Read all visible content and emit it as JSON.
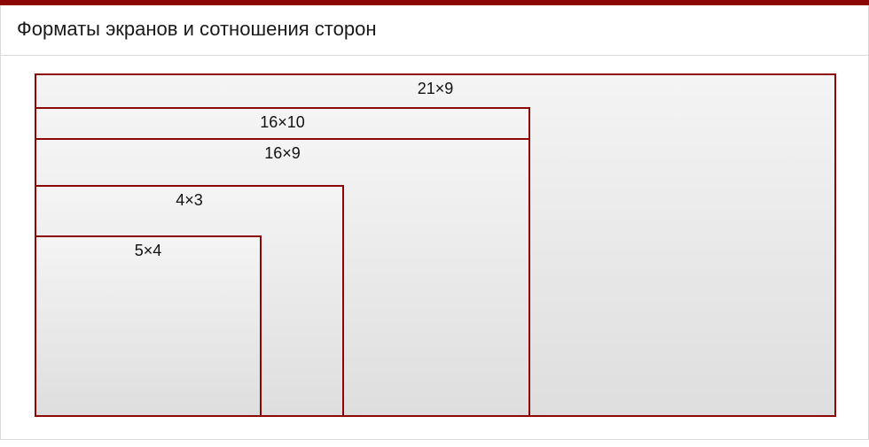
{
  "colors": {
    "accent": "#8d0606",
    "border": "#d9d9d9"
  },
  "header": {
    "title": "Форматы экранов и сотношения сторон"
  },
  "ratios": [
    {
      "label": "21×9",
      "wpx": 904,
      "hpx": 388
    },
    {
      "label": "16×10",
      "wpx": 559,
      "hpx": 350
    },
    {
      "label": "16×9",
      "wpx": 559,
      "hpx": 315
    },
    {
      "label": "4×3",
      "wpx": 349,
      "hpx": 262
    },
    {
      "label": "5×4",
      "wpx": 256,
      "hpx": 205
    }
  ]
}
